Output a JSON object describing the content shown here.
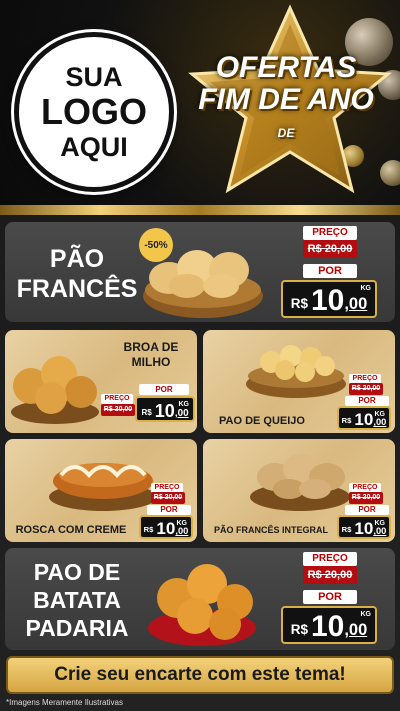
{
  "header": {
    "logo_lines": [
      "SUA",
      "LOGO",
      "AQUI"
    ],
    "title_line1": "OFERTAS",
    "title_de": "DE",
    "title_line2": "FIM DE ANO"
  },
  "products": [
    {
      "name_lines": [
        "PÃO",
        "FRANCÊS"
      ],
      "badge": "-50%",
      "preco_label": "PREÇO",
      "old_price": "R$ 20,00",
      "por_label": "POR",
      "currency": "R$",
      "price_int": "10",
      "price_dec": ",00",
      "unit": "KG"
    },
    {
      "name_lines": [
        "BROA DE",
        "MILHO"
      ],
      "preco_label": "PREÇO",
      "old_price": "R$ 20,00",
      "por_label": "POR",
      "currency": "R$",
      "price_int": "10",
      "price_dec": ",00",
      "unit": "KG"
    },
    {
      "name": "PAO DE QUEIJO",
      "preco_label": "PREÇO",
      "old_price": "R$ 20,00",
      "por_label": "POR",
      "currency": "R$",
      "price_int": "10",
      "price_dec": ",00",
      "unit": "KG"
    },
    {
      "name": "ROSCA COM CREME",
      "preco_label": "PREÇO",
      "old_price": "R$ 20,00",
      "por_label": "POR",
      "currency": "R$",
      "price_int": "10",
      "price_dec": ",00",
      "unit": "KG"
    },
    {
      "name": "PÃO FRANCÊS INTEGRAL",
      "preco_label": "PREÇO",
      "old_price": "R$ 20,00",
      "por_label": "POR",
      "currency": "R$",
      "price_int": "10",
      "price_dec": ",00",
      "unit": "KG"
    },
    {
      "name_lines": [
        "PAO DE",
        "BATATA",
        "PADARIA"
      ],
      "preco_label": "PREÇO",
      "old_price": "R$ 20,00",
      "por_label": "POR",
      "currency": "R$",
      "price_int": "10",
      "price_dec": ",00",
      "unit": "KG"
    }
  ],
  "footer": {
    "cta": "Crie seu encarte com este tema!",
    "disclaimer": "*Imagens Meramente Ilustrativas"
  },
  "colors": {
    "gold": "#d9b045",
    "red": "#b30d12",
    "dark_panel": "#404040",
    "wood": "#dfc28c"
  }
}
